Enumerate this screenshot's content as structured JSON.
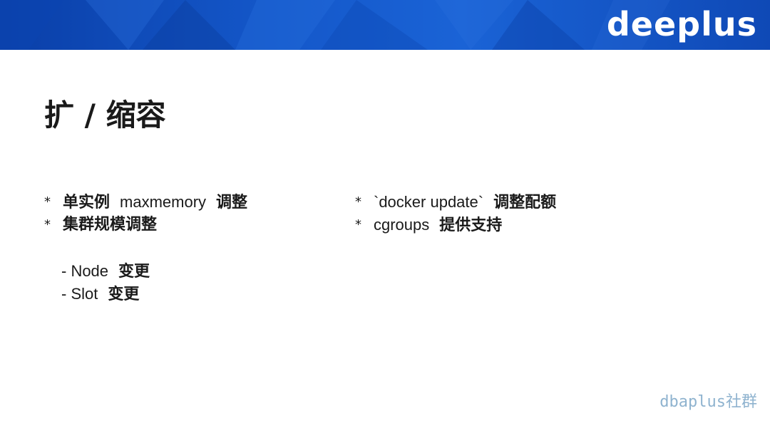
{
  "header": {
    "logo_text": "deeplus",
    "colors": {
      "banner_dark": "#0a3fa8",
      "banner_light": "#1a63d6"
    }
  },
  "title": "扩 / 缩容",
  "left_column": {
    "bullet_1": {
      "marker": "*",
      "pre": "单实例",
      "mid": "maxmemory",
      "post": "调整"
    },
    "bullet_2": {
      "marker": "*",
      "text": "集群规模调整"
    },
    "sub_1": {
      "pre": "- Node",
      "post": "变更"
    },
    "sub_2": {
      "pre": "- Slot",
      "post": "变更"
    }
  },
  "right_column": {
    "bullet_1": {
      "marker": "*",
      "code": "`docker update`",
      "post": "调整配额"
    },
    "bullet_2": {
      "marker": "*",
      "code": "cgroups",
      "post": "提供支持"
    }
  },
  "watermark": "dbaplus社群"
}
